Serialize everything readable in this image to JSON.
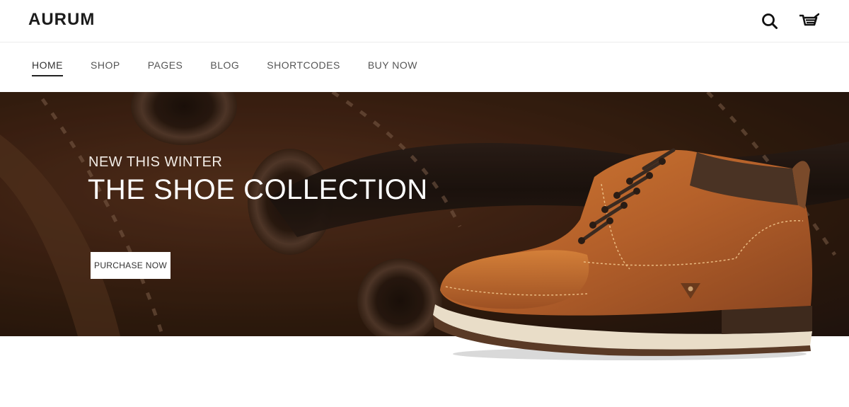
{
  "header": {
    "logo": "AURUM",
    "icons": [
      "search-icon",
      "cart-icon"
    ]
  },
  "nav": {
    "items": [
      {
        "label": "HOME",
        "active": true
      },
      {
        "label": "SHOP",
        "active": false
      },
      {
        "label": "PAGES",
        "active": false
      },
      {
        "label": "BLOG",
        "active": false
      },
      {
        "label": "SHORTCODES",
        "active": false
      },
      {
        "label": "BUY NOW",
        "active": false
      }
    ]
  },
  "hero": {
    "subtitle": "NEW THIS WINTER",
    "title": "THE SHOE COLLECTION",
    "button_label": "PURCHASE NOW"
  },
  "colors": {
    "hero_bg": "#4e2b18",
    "leather": "#b8642a",
    "collar": "#4a3324",
    "sole": "#e8dcc6"
  }
}
